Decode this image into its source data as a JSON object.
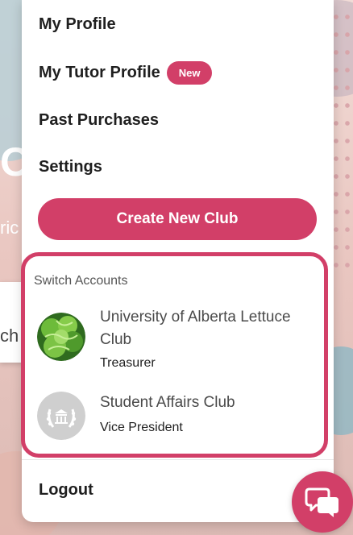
{
  "background": {
    "hero_letter": "O",
    "hero_text": "ric",
    "search_fragment": "ch"
  },
  "menu": {
    "items": {
      "my_profile": "My Profile",
      "my_tutor_profile": "My Tutor Profile",
      "new_badge": "New",
      "past_purchases": "Past Purchases",
      "settings": "Settings",
      "logout": "Logout"
    },
    "create_club_label": "Create New Club",
    "switch_accounts": {
      "title": "Switch Accounts",
      "accounts": [
        {
          "name": "University of Alberta Lettuce Club",
          "role": "Treasurer",
          "avatar": "lettuce-photo"
        },
        {
          "name": "Student Affairs Club",
          "role": "Vice President",
          "avatar": "university-crest-icon"
        }
      ]
    }
  },
  "chat_fab_icon": "chat-bubbles-icon",
  "colors": {
    "accent": "#d23f68",
    "text_dark": "#1f1f1f",
    "text_muted": "#4a4a4a"
  }
}
